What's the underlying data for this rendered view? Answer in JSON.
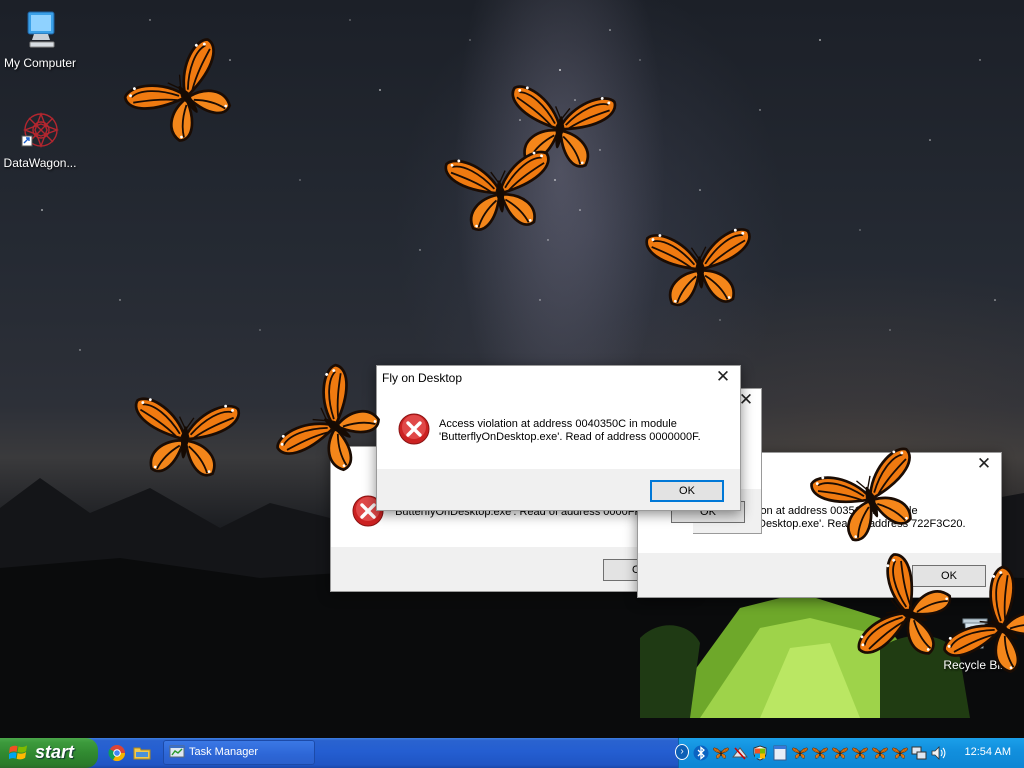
{
  "desktop": {
    "icons": [
      {
        "label": "My Computer"
      },
      {
        "label": "DataWagon..."
      },
      {
        "label": "Recycle Bin"
      }
    ]
  },
  "dialogs": [
    {
      "title": "",
      "message_line1": "",
      "message_line2": "'ButterflyOnDesktop.exe'. Read of address 0000FFFF.",
      "ok_label": "OK"
    },
    {
      "title": "",
      "message_line1": "ion at address 003515 in module",
      "message_line2": "Desktop.exe'. Read of address 722F3C20.",
      "ok_label": "OK"
    },
    {
      "title": "",
      "ok_label": "OK"
    },
    {
      "title": "Fly on Desktop",
      "message_line1": "Access violation at address 0040350C in module",
      "message_line2": "'ButterflyOnDesktop.exe'. Read of address 0000000F.",
      "ok_label": "OK"
    }
  ],
  "taskbar": {
    "start_label": "start",
    "quick_launch": [
      "chrome-icon",
      "folder-icon"
    ],
    "tasks": [
      {
        "label": "Task Manager"
      }
    ],
    "tray_icons": [
      "bluetooth-icon",
      "butterfly-icon",
      "network-disabled-icon",
      "security-shield-icon",
      "window-icon",
      "butterfly-icon",
      "network-icon",
      "volume-icon"
    ],
    "clock": "12:54 AM"
  },
  "colors": {
    "taskbar_blue": "#245ed1",
    "start_green": "#318a31",
    "tray_blue": "#1290de",
    "butterfly_orange": "#f07a10",
    "error_red": "#d12a2a"
  }
}
